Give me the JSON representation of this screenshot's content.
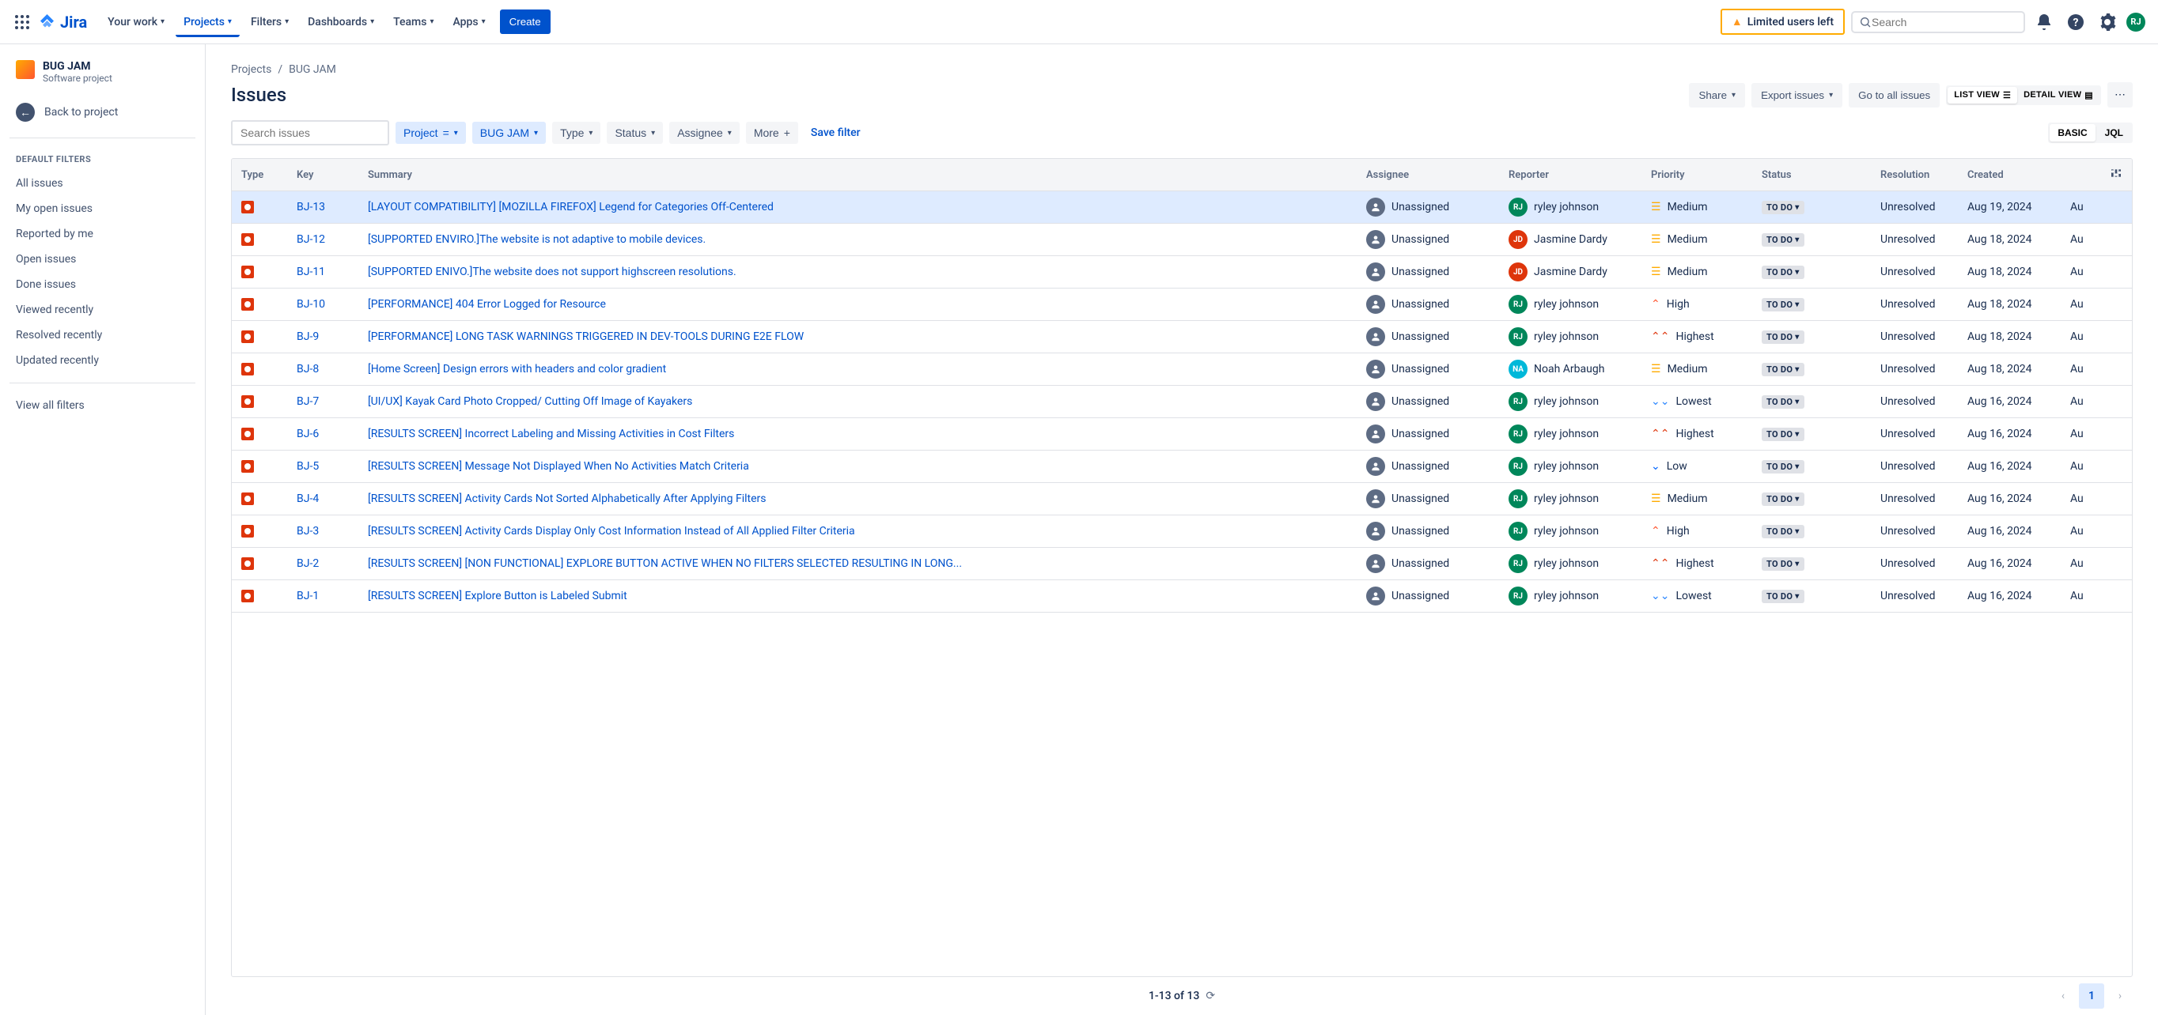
{
  "top_nav": {
    "product": "Jira",
    "items": [
      "Your work",
      "Projects",
      "Filters",
      "Dashboards",
      "Teams",
      "Apps"
    ],
    "active_index": 1,
    "create": "Create",
    "banner": "Limited users left",
    "search_placeholder": "Search",
    "user_initials": "RJ"
  },
  "sidebar": {
    "project_name": "BUG JAM",
    "project_type": "Software project",
    "back_label": "Back to project",
    "section_title": "DEFAULT FILTERS",
    "filters": [
      "All issues",
      "My open issues",
      "Reported by me",
      "Open issues",
      "Done issues",
      "Viewed recently",
      "Resolved recently",
      "Updated recently"
    ],
    "view_all": "View all filters"
  },
  "breadcrumb": {
    "root": "Projects",
    "project": "BUG JAM"
  },
  "page_title": "Issues",
  "actions": {
    "share": "Share",
    "export": "Export issues",
    "go_to_all": "Go to all issues",
    "list_view": "LIST VIEW",
    "detail_view": "DETAIL VIEW"
  },
  "filter_bar": {
    "search_placeholder": "Search issues",
    "project_label": "Project",
    "project_value": "BUG JAM",
    "type": "Type",
    "status": "Status",
    "assignee": "Assignee",
    "more": "More",
    "save": "Save filter",
    "basic": "BASIC",
    "jql": "JQL"
  },
  "columns": [
    "Type",
    "Key",
    "Summary",
    "Assignee",
    "Reporter",
    "Priority",
    "Status",
    "Resolution",
    "Created",
    ""
  ],
  "status_label": "TO DO",
  "assignee_default": "Unassigned",
  "issues": [
    {
      "key": "BJ-13",
      "summary": "[LAYOUT COMPATIBILITY] [MOZILLA FIREFOX] Legend for Categories Off-Centered",
      "reporter": "ryley johnson",
      "reporter_av": "rj",
      "priority": "Medium",
      "resolution": "Unresolved",
      "created": "Aug 19, 2024",
      "updated": "Au",
      "selected": true
    },
    {
      "key": "BJ-12",
      "summary": "[SUPPORTED ENVIRO.]The website is not adaptive to mobile devices.",
      "reporter": "Jasmine Dardy",
      "reporter_av": "jd",
      "priority": "Medium",
      "resolution": "Unresolved",
      "created": "Aug 18, 2024",
      "updated": "Au"
    },
    {
      "key": "BJ-11",
      "summary": "[SUPPORTED ENIVO.]The website does not support highscreen resolutions.",
      "reporter": "Jasmine Dardy",
      "reporter_av": "jd",
      "priority": "Medium",
      "resolution": "Unresolved",
      "created": "Aug 18, 2024",
      "updated": "Au"
    },
    {
      "key": "BJ-10",
      "summary": "[PERFORMANCE] 404 Error Logged for Resource",
      "reporter": "ryley johnson",
      "reporter_av": "rj",
      "priority": "High",
      "resolution": "Unresolved",
      "created": "Aug 18, 2024",
      "updated": "Au"
    },
    {
      "key": "BJ-9",
      "summary": "[PERFORMANCE] LONG TASK WARNINGS TRIGGERED IN DEV-TOOLS DURING E2E FLOW",
      "reporter": "ryley johnson",
      "reporter_av": "rj",
      "priority": "Highest",
      "resolution": "Unresolved",
      "created": "Aug 18, 2024",
      "updated": "Au"
    },
    {
      "key": "BJ-8",
      "summary": "[Home Screen] Design errors with headers and color gradient",
      "reporter": "Noah Arbaugh",
      "reporter_av": "na",
      "priority": "Medium",
      "resolution": "Unresolved",
      "created": "Aug 18, 2024",
      "updated": "Au"
    },
    {
      "key": "BJ-7",
      "summary": "[UI/UX] Kayak Card Photo Cropped/ Cutting Off Image of Kayakers",
      "reporter": "ryley johnson",
      "reporter_av": "rj",
      "priority": "Lowest",
      "resolution": "Unresolved",
      "created": "Aug 16, 2024",
      "updated": "Au"
    },
    {
      "key": "BJ-6",
      "summary": "[RESULTS SCREEN] Incorrect Labeling and Missing Activities in Cost Filters",
      "reporter": "ryley johnson",
      "reporter_av": "rj",
      "priority": "Highest",
      "resolution": "Unresolved",
      "created": "Aug 16, 2024",
      "updated": "Au"
    },
    {
      "key": "BJ-5",
      "summary": "[RESULTS SCREEN] Message Not Displayed When No Activities Match Criteria",
      "reporter": "ryley johnson",
      "reporter_av": "rj",
      "priority": "Low",
      "resolution": "Unresolved",
      "created": "Aug 16, 2024",
      "updated": "Au"
    },
    {
      "key": "BJ-4",
      "summary": "[RESULTS SCREEN] Activity Cards Not Sorted Alphabetically After Applying Filters",
      "reporter": "ryley johnson",
      "reporter_av": "rj",
      "priority": "Medium",
      "resolution": "Unresolved",
      "created": "Aug 16, 2024",
      "updated": "Au"
    },
    {
      "key": "BJ-3",
      "summary": "[RESULTS SCREEN] Activity Cards Display Only Cost Information Instead of All Applied Filter Criteria",
      "reporter": "ryley johnson",
      "reporter_av": "rj",
      "priority": "High",
      "resolution": "Unresolved",
      "created": "Aug 16, 2024",
      "updated": "Au"
    },
    {
      "key": "BJ-2",
      "summary": "[RESULTS SCREEN] [NON FUNCTIONAL] EXPLORE BUTTON ACTIVE WHEN NO FILTERS SELECTED RESULTING IN LONG...",
      "reporter": "ryley johnson",
      "reporter_av": "rj",
      "priority": "Highest",
      "resolution": "Unresolved",
      "created": "Aug 16, 2024",
      "updated": "Au"
    },
    {
      "key": "BJ-1",
      "summary": "[RESULTS SCREEN] Explore Button is Labeled Submit",
      "reporter": "ryley johnson",
      "reporter_av": "rj",
      "priority": "Lowest",
      "resolution": "Unresolved",
      "created": "Aug 16, 2024",
      "updated": "Au"
    }
  ],
  "pagination": {
    "info": "1-13 of 13",
    "current": "1"
  }
}
